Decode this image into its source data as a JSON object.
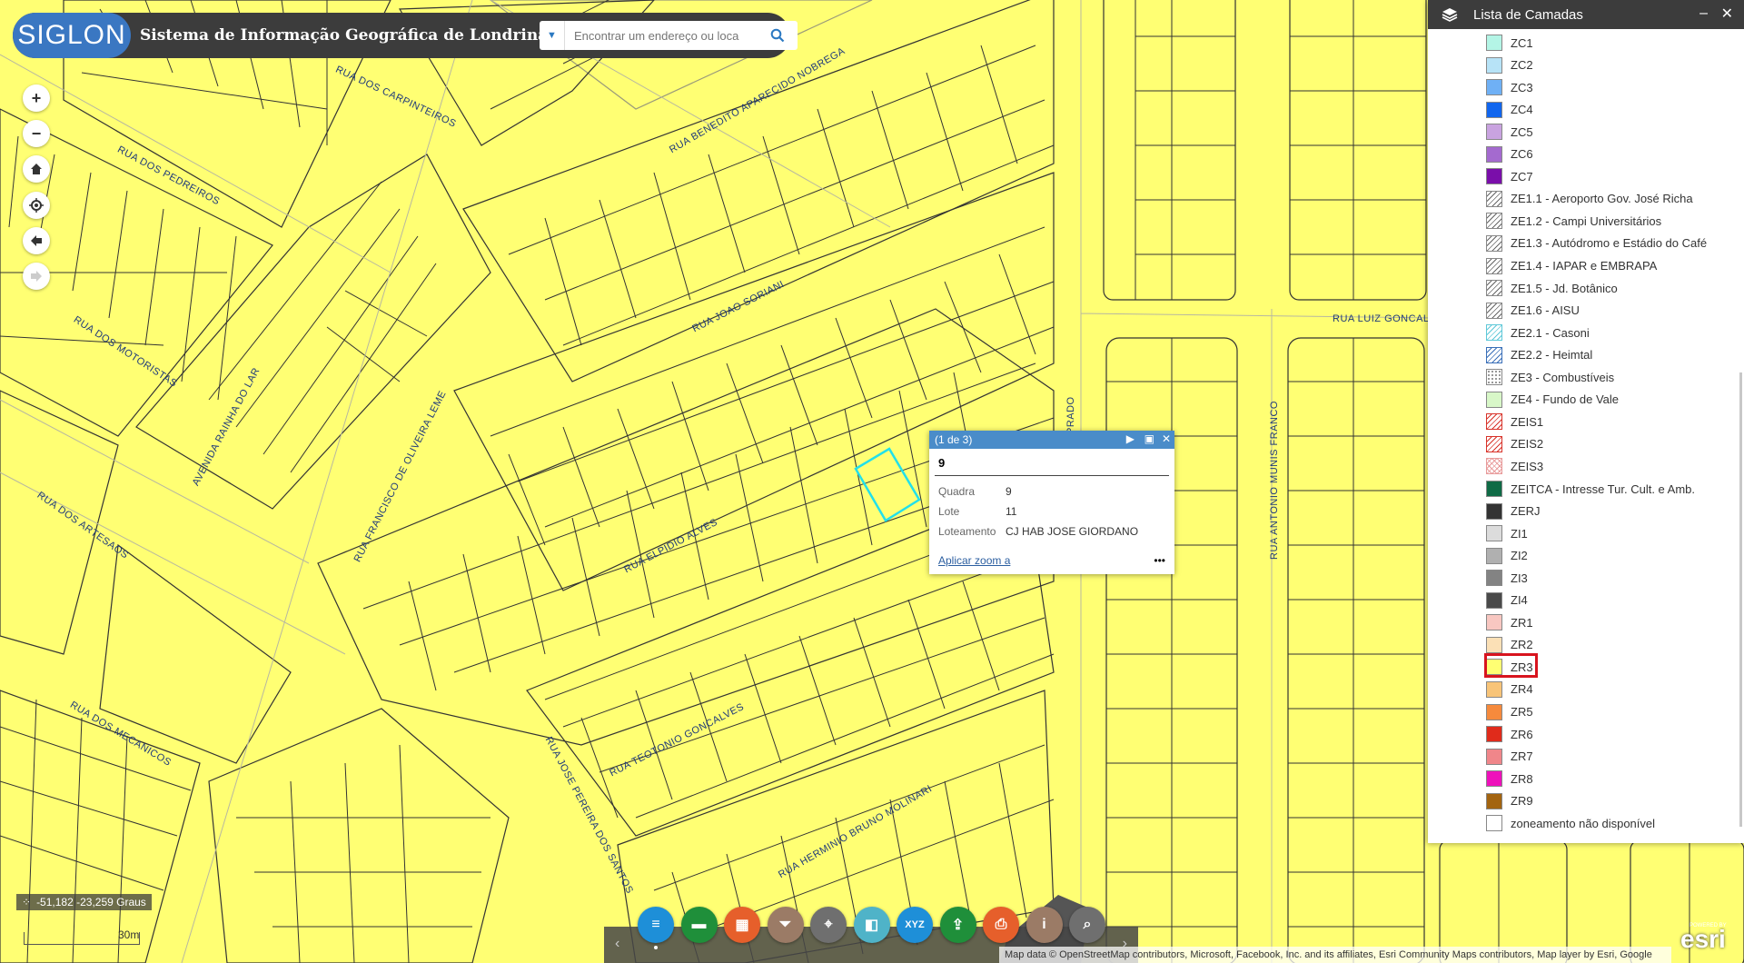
{
  "header": {
    "logo_text": "SIGLON",
    "title": "Sistema de Informação Geográfica de Londrina",
    "search_placeholder": "Encontrar um endereço ou loca"
  },
  "map_controls": {
    "zoom_in": "+",
    "zoom_out": "−"
  },
  "streets": [
    "RUA DOS CARPINTEIROS",
    "RUA BENEDITO APARECIDO NOBREGA",
    "RUA DOS PEDREIROS",
    "RUA JOAO SORIANI",
    "RUA DOS MOTORISTAS",
    "AVENIDA RAINHA DO LAR",
    "RUA FRANCISCO DE OLIVEIRA LEME",
    "RUA DOS ARTESAOS",
    "RUA ELPIDIO ALVES",
    "RUA TEOTONIO GONCALVES",
    "RUA DOS MECANICOS",
    "RUA JOSE PEREIRA DOS SANTOS",
    "RUA HERMINIO BRUNO MOLINARI",
    "RUA ANTONIO MUNIS FRANCO",
    "RUA LUIZ GONCALV",
    "PRADO"
  ],
  "popup": {
    "counter": "(1 de 3)",
    "title": "9",
    "fields": [
      {
        "key": "Quadra",
        "value": "9"
      },
      {
        "key": "Lote",
        "value": "11"
      },
      {
        "key": "Loteamento",
        "value": "CJ HAB JOSE GIORDANO"
      }
    ],
    "zoom_link": "Aplicar zoom a",
    "more": "•••"
  },
  "layer_panel": {
    "title": "Lista de Camadas",
    "minimize": "–",
    "close": "✕",
    "highlighted": "ZR3",
    "items": [
      {
        "label": "ZC1",
        "color": "#b4f5e6",
        "pattern": "solid"
      },
      {
        "label": "ZC2",
        "color": "#b7e3f7",
        "pattern": "solid"
      },
      {
        "label": "ZC3",
        "color": "#6fb0f5",
        "pattern": "solid"
      },
      {
        "label": "ZC4",
        "color": "#1166ee",
        "pattern": "solid"
      },
      {
        "label": "ZC5",
        "color": "#c9a3e0",
        "pattern": "solid"
      },
      {
        "label": "ZC6",
        "color": "#a46acf",
        "pattern": "solid"
      },
      {
        "label": "ZC7",
        "color": "#7a0eaa",
        "pattern": "solid"
      },
      {
        "label": "ZE1.1 - Aeroporto Gov. José Richa",
        "color": "#666666",
        "pattern": "hatch"
      },
      {
        "label": "ZE1.2 - Campi Universitários",
        "color": "#666666",
        "pattern": "hatch"
      },
      {
        "label": "ZE1.3 - Autódromo e Estádio do Café",
        "color": "#666666",
        "pattern": "hatch"
      },
      {
        "label": "ZE1.4 - IAPAR e EMBRAPA",
        "color": "#666666",
        "pattern": "hatch"
      },
      {
        "label": "ZE1.5 - Jd. Botânico",
        "color": "#666666",
        "pattern": "hatch"
      },
      {
        "label": "ZE1.6 - AISU",
        "color": "#666666",
        "pattern": "hatch"
      },
      {
        "label": "ZE2.1 - Casoni",
        "color": "#5fc8d8",
        "pattern": "hatch-c"
      },
      {
        "label": "ZE2.2 - Heimtal",
        "color": "#3a6fb8",
        "pattern": "hatch-b"
      },
      {
        "label": "ZE3 - Combustíveis",
        "color": "#777777",
        "pattern": "dots"
      },
      {
        "label": "ZE4 - Fundo de Vale",
        "color": "#d8f7c8",
        "pattern": "solid"
      },
      {
        "label": "ZEIS1",
        "color": "#d8332a",
        "pattern": "hatch-r"
      },
      {
        "label": "ZEIS2",
        "color": "#d8332a",
        "pattern": "hatch-r"
      },
      {
        "label": "ZEIS3",
        "color": "#e89a9a",
        "pattern": "cross-r"
      },
      {
        "label": "ZEITCA - Intresse Tur. Cult. e Amb.",
        "color": "#0f6b46",
        "pattern": "solid"
      },
      {
        "label": "ZERJ",
        "color": "#333333",
        "pattern": "solid"
      },
      {
        "label": "ZI1",
        "color": "#dcdcdc",
        "pattern": "solid"
      },
      {
        "label": "ZI2",
        "color": "#b0b0b0",
        "pattern": "solid"
      },
      {
        "label": "ZI3",
        "color": "#838383",
        "pattern": "solid"
      },
      {
        "label": "ZI4",
        "color": "#4a4a4a",
        "pattern": "solid"
      },
      {
        "label": "ZR1",
        "color": "#f8c7c1",
        "pattern": "solid"
      },
      {
        "label": "ZR2",
        "color": "#fbe0b6",
        "pattern": "solid"
      },
      {
        "label": "ZR3",
        "color": "#ffff73",
        "pattern": "solid"
      },
      {
        "label": "ZR4",
        "color": "#f8c478",
        "pattern": "solid"
      },
      {
        "label": "ZR5",
        "color": "#f68a3c",
        "pattern": "solid"
      },
      {
        "label": "ZR6",
        "color": "#e02b1b",
        "pattern": "solid"
      },
      {
        "label": "ZR7",
        "color": "#f0868a",
        "pattern": "solid"
      },
      {
        "label": "ZR8",
        "color": "#ee11bb",
        "pattern": "solid"
      },
      {
        "label": "ZR9",
        "color": "#a36410",
        "pattern": "solid"
      },
      {
        "label": "zoneamento não disponível",
        "color": "#ffffff",
        "pattern": "solid"
      }
    ]
  },
  "coords": "-51,182 -23,259 Graus",
  "scale": "30m",
  "toolbar": {
    "prev": "‹",
    "next": "›",
    "tools": [
      {
        "name": "layers",
        "icon": "layers-icon",
        "color": "#1e8fd8"
      },
      {
        "name": "measure",
        "icon": "ruler-icon",
        "color": "#1f8f3a"
      },
      {
        "name": "basemap",
        "icon": "grid-icon",
        "color": "#e65f2b"
      },
      {
        "name": "filter",
        "icon": "filter-icon",
        "color": "#9b7b66"
      },
      {
        "name": "locate",
        "icon": "location-icon",
        "color": "#6f6f6f"
      },
      {
        "name": "swipe",
        "icon": "swipe-icon",
        "color": "#4fb3c8"
      },
      {
        "name": "xyz",
        "icon": "xyz-icon",
        "color": "#1e8fd8"
      },
      {
        "name": "share",
        "icon": "share-icon",
        "color": "#1f8f3a"
      },
      {
        "name": "print",
        "icon": "print-icon",
        "color": "#e65f2b"
      },
      {
        "name": "about",
        "icon": "info-icon",
        "color": "#9b7b66"
      },
      {
        "name": "query",
        "icon": "query-icon",
        "color": "#6f6f6f"
      }
    ],
    "xyz_label": "XYZ"
  },
  "attribution": "Map data © OpenStreetMap contributors, Microsoft, Facebook, Inc. and its affiliates, Esri Community Maps contributors, Map layer by Esri, Google",
  "esri": {
    "powered": "POWERED BY",
    "logo": "esri"
  }
}
